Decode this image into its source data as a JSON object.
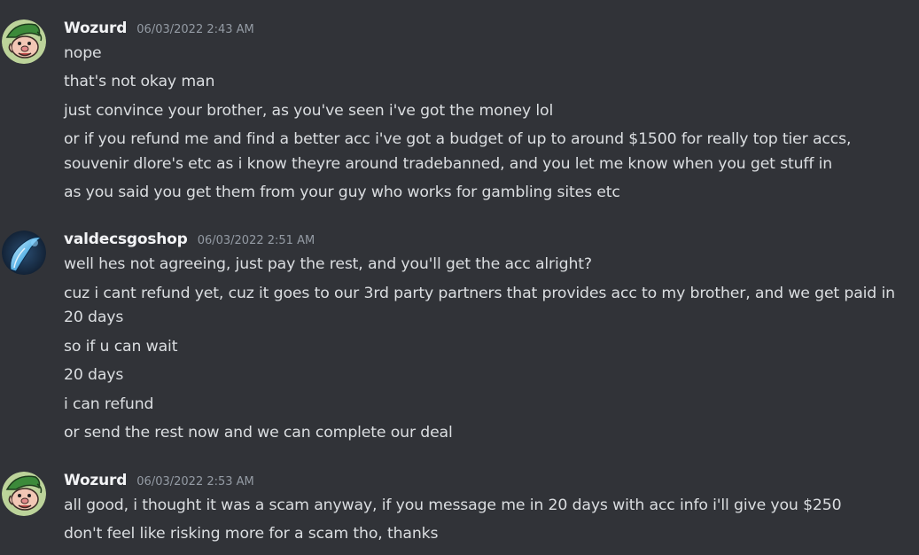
{
  "messages": [
    {
      "author": "Wozurd",
      "timestamp": "06/03/2022 2:43 AM",
      "avatar": "elf-face",
      "lines": [
        "nope",
        "that's not okay man",
        "just convince your brother, as you've seen i've got the money lol",
        [
          "or if you refund me and find a better acc i've got a budget of up to around $1500 for really top tier accs,",
          "souvenir dlore's etc as i know theyre around tradebanned, and you let me know when you get stuff in"
        ],
        "as you said you get them from your guy who works for gambling sites etc"
      ]
    },
    {
      "author": "valdecsgoshop",
      "timestamp": "06/03/2022 2:51 AM",
      "avatar": "blue-knife",
      "lines": [
        "well hes not agreeing, just pay the rest, and you'll get the acc alright?",
        [
          "cuz i cant refund yet, cuz it goes to our 3rd party partners that provides acc to my brother, and we get paid in",
          "20 days"
        ],
        "so if u can wait",
        "20 days",
        "i can refund",
        "or send the rest now and we can complete our deal"
      ]
    },
    {
      "author": "Wozurd",
      "timestamp": "06/03/2022 2:53 AM",
      "avatar": "elf-face",
      "lines": [
        "all good, i thought it was a scam anyway, if you message me in 20 days with acc info i'll give you $250",
        "don't feel like risking more for a scam tho, thanks"
      ]
    }
  ]
}
